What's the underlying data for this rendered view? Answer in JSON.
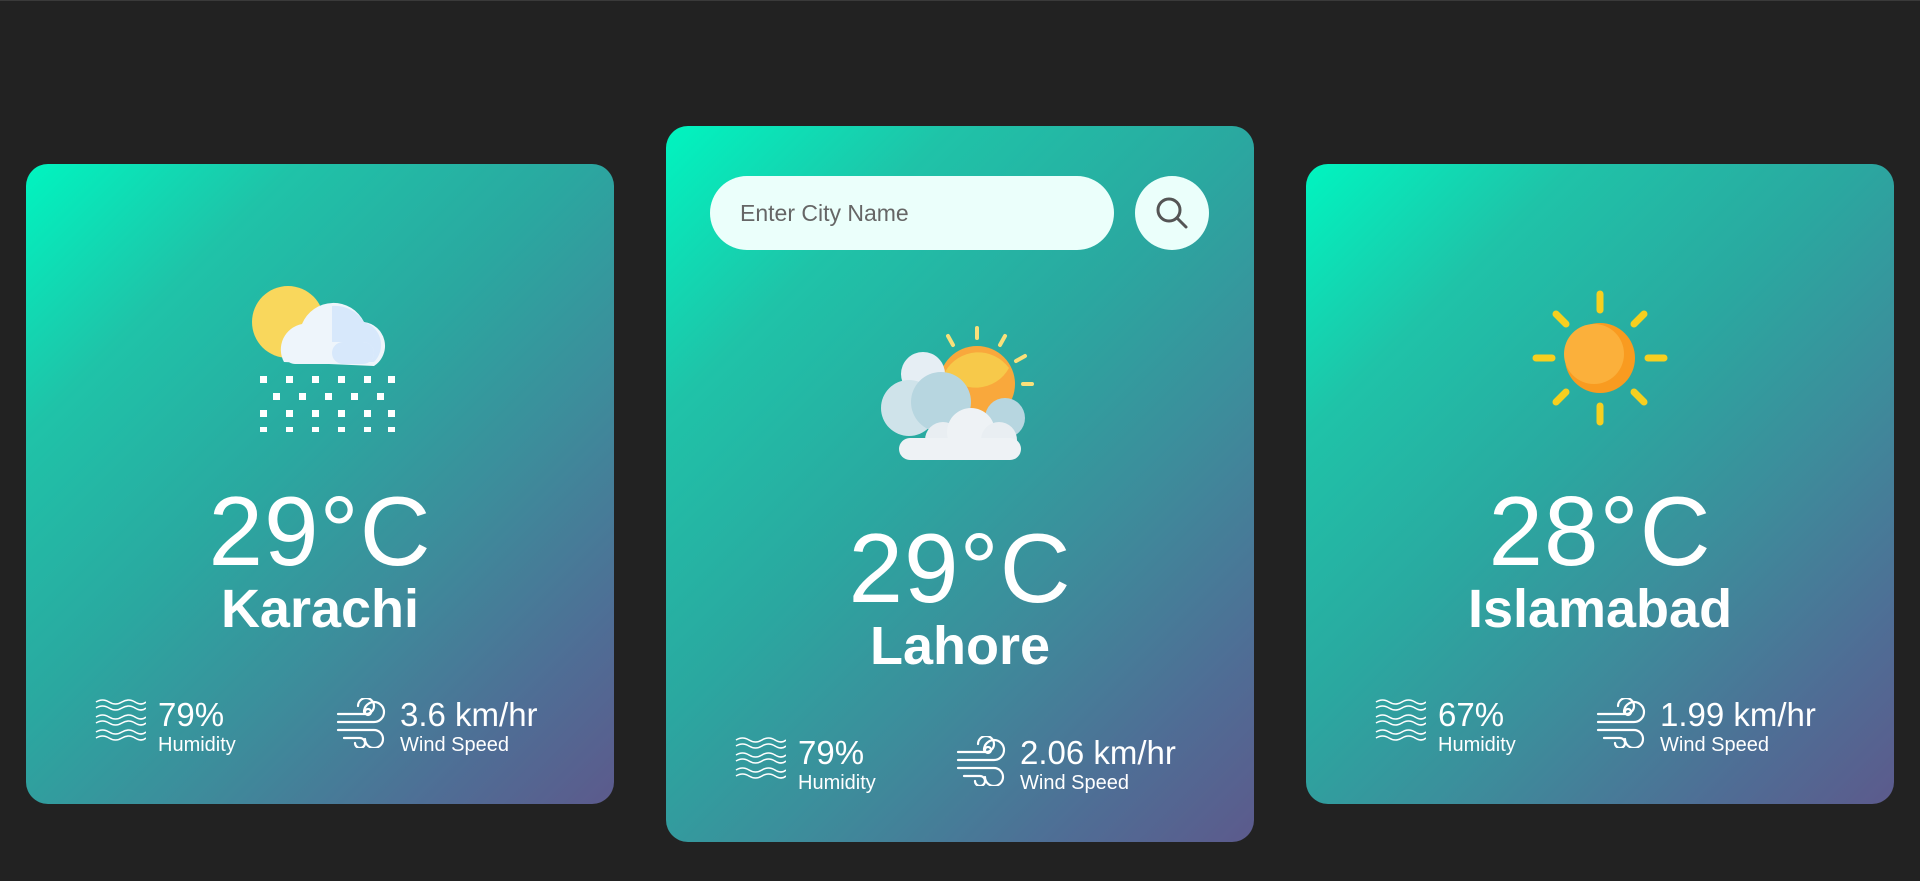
{
  "search": {
    "placeholder": "Enter City Name",
    "icon": "search-icon"
  },
  "cards": [
    {
      "city": "Karachi",
      "temperature": "29°C",
      "icon": "rain-snow-cloud-sun-icon",
      "humidity": "79%",
      "humidity_label": "Humidity",
      "wind_speed": "3.6 km/hr",
      "wind_label": "Wind Speed"
    },
    {
      "city": "Lahore",
      "temperature": "29°C",
      "icon": "partly-cloudy-sun-icon",
      "humidity": "79%",
      "humidity_label": "Humidity",
      "wind_speed": "2.06 km/hr",
      "wind_label": "Wind Speed"
    },
    {
      "city": "Islamabad",
      "temperature": "28°C",
      "icon": "sun-icon",
      "humidity": "67%",
      "humidity_label": "Humidity",
      "wind_speed": "1.99 km/hr",
      "wind_label": "Wind Speed"
    }
  ],
  "colors": {
    "background": "#222222",
    "card_gradient_start": "#00f5c0",
    "card_gradient_end": "#5c5a8c",
    "input_background": "#ebfffb"
  }
}
